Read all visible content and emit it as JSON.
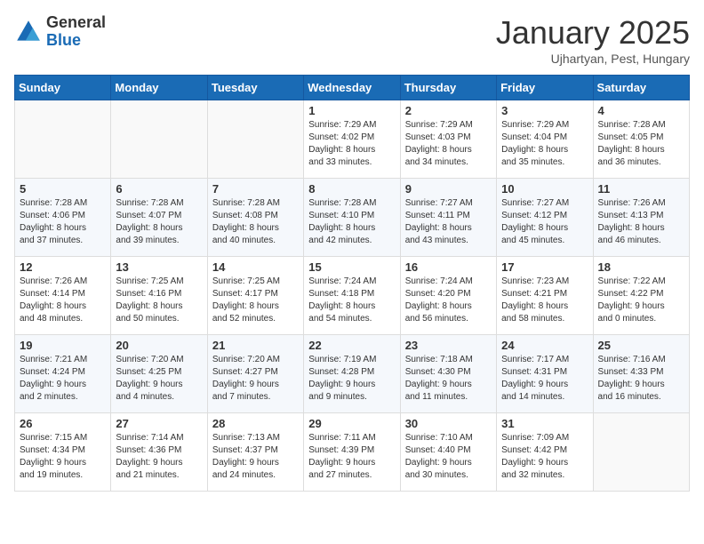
{
  "logo": {
    "general": "General",
    "blue": "Blue"
  },
  "title": "January 2025",
  "subtitle": "Ujhartyan, Pest, Hungary",
  "days_of_week": [
    "Sunday",
    "Monday",
    "Tuesday",
    "Wednesday",
    "Thursday",
    "Friday",
    "Saturday"
  ],
  "weeks": [
    [
      {
        "day": "",
        "info": ""
      },
      {
        "day": "",
        "info": ""
      },
      {
        "day": "",
        "info": ""
      },
      {
        "day": "1",
        "info": "Sunrise: 7:29 AM\nSunset: 4:02 PM\nDaylight: 8 hours\nand 33 minutes."
      },
      {
        "day": "2",
        "info": "Sunrise: 7:29 AM\nSunset: 4:03 PM\nDaylight: 8 hours\nand 34 minutes."
      },
      {
        "day": "3",
        "info": "Sunrise: 7:29 AM\nSunset: 4:04 PM\nDaylight: 8 hours\nand 35 minutes."
      },
      {
        "day": "4",
        "info": "Sunrise: 7:28 AM\nSunset: 4:05 PM\nDaylight: 8 hours\nand 36 minutes."
      }
    ],
    [
      {
        "day": "5",
        "info": "Sunrise: 7:28 AM\nSunset: 4:06 PM\nDaylight: 8 hours\nand 37 minutes."
      },
      {
        "day": "6",
        "info": "Sunrise: 7:28 AM\nSunset: 4:07 PM\nDaylight: 8 hours\nand 39 minutes."
      },
      {
        "day": "7",
        "info": "Sunrise: 7:28 AM\nSunset: 4:08 PM\nDaylight: 8 hours\nand 40 minutes."
      },
      {
        "day": "8",
        "info": "Sunrise: 7:28 AM\nSunset: 4:10 PM\nDaylight: 8 hours\nand 42 minutes."
      },
      {
        "day": "9",
        "info": "Sunrise: 7:27 AM\nSunset: 4:11 PM\nDaylight: 8 hours\nand 43 minutes."
      },
      {
        "day": "10",
        "info": "Sunrise: 7:27 AM\nSunset: 4:12 PM\nDaylight: 8 hours\nand 45 minutes."
      },
      {
        "day": "11",
        "info": "Sunrise: 7:26 AM\nSunset: 4:13 PM\nDaylight: 8 hours\nand 46 minutes."
      }
    ],
    [
      {
        "day": "12",
        "info": "Sunrise: 7:26 AM\nSunset: 4:14 PM\nDaylight: 8 hours\nand 48 minutes."
      },
      {
        "day": "13",
        "info": "Sunrise: 7:25 AM\nSunset: 4:16 PM\nDaylight: 8 hours\nand 50 minutes."
      },
      {
        "day": "14",
        "info": "Sunrise: 7:25 AM\nSunset: 4:17 PM\nDaylight: 8 hours\nand 52 minutes."
      },
      {
        "day": "15",
        "info": "Sunrise: 7:24 AM\nSunset: 4:18 PM\nDaylight: 8 hours\nand 54 minutes."
      },
      {
        "day": "16",
        "info": "Sunrise: 7:24 AM\nSunset: 4:20 PM\nDaylight: 8 hours\nand 56 minutes."
      },
      {
        "day": "17",
        "info": "Sunrise: 7:23 AM\nSunset: 4:21 PM\nDaylight: 8 hours\nand 58 minutes."
      },
      {
        "day": "18",
        "info": "Sunrise: 7:22 AM\nSunset: 4:22 PM\nDaylight: 9 hours\nand 0 minutes."
      }
    ],
    [
      {
        "day": "19",
        "info": "Sunrise: 7:21 AM\nSunset: 4:24 PM\nDaylight: 9 hours\nand 2 minutes."
      },
      {
        "day": "20",
        "info": "Sunrise: 7:20 AM\nSunset: 4:25 PM\nDaylight: 9 hours\nand 4 minutes."
      },
      {
        "day": "21",
        "info": "Sunrise: 7:20 AM\nSunset: 4:27 PM\nDaylight: 9 hours\nand 7 minutes."
      },
      {
        "day": "22",
        "info": "Sunrise: 7:19 AM\nSunset: 4:28 PM\nDaylight: 9 hours\nand 9 minutes."
      },
      {
        "day": "23",
        "info": "Sunrise: 7:18 AM\nSunset: 4:30 PM\nDaylight: 9 hours\nand 11 minutes."
      },
      {
        "day": "24",
        "info": "Sunrise: 7:17 AM\nSunset: 4:31 PM\nDaylight: 9 hours\nand 14 minutes."
      },
      {
        "day": "25",
        "info": "Sunrise: 7:16 AM\nSunset: 4:33 PM\nDaylight: 9 hours\nand 16 minutes."
      }
    ],
    [
      {
        "day": "26",
        "info": "Sunrise: 7:15 AM\nSunset: 4:34 PM\nDaylight: 9 hours\nand 19 minutes."
      },
      {
        "day": "27",
        "info": "Sunrise: 7:14 AM\nSunset: 4:36 PM\nDaylight: 9 hours\nand 21 minutes."
      },
      {
        "day": "28",
        "info": "Sunrise: 7:13 AM\nSunset: 4:37 PM\nDaylight: 9 hours\nand 24 minutes."
      },
      {
        "day": "29",
        "info": "Sunrise: 7:11 AM\nSunset: 4:39 PM\nDaylight: 9 hours\nand 27 minutes."
      },
      {
        "day": "30",
        "info": "Sunrise: 7:10 AM\nSunset: 4:40 PM\nDaylight: 9 hours\nand 30 minutes."
      },
      {
        "day": "31",
        "info": "Sunrise: 7:09 AM\nSunset: 4:42 PM\nDaylight: 9 hours\nand 32 minutes."
      },
      {
        "day": "",
        "info": ""
      }
    ]
  ]
}
